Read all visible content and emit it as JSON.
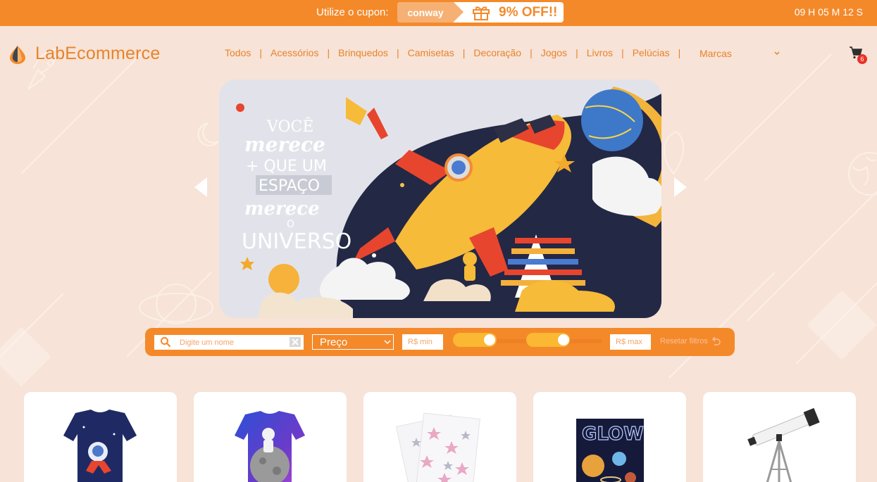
{
  "topbar": {
    "coupon_text": "Utilize o cupon:",
    "coupon_code": "conway",
    "discount": "9% OFF!!",
    "timer": "09 H 05 M 12 S"
  },
  "logo": {
    "text": "LabEcommerce"
  },
  "nav": {
    "items": [
      "Todos",
      "Acessórios",
      "Brinquedos",
      "Camisetas",
      "Decoração",
      "Jogos",
      "Livros",
      "Pelúcias"
    ],
    "brands_label": "Marcas"
  },
  "cart": {
    "count": "6"
  },
  "banner": {
    "lines": [
      "VOCÊ",
      "merece",
      "+ QUE UM",
      "ESPAÇO",
      "merece",
      "O",
      "UNIVERSO"
    ]
  },
  "filters": {
    "search_placeholder": "Digite um nome",
    "sort_selected": "Preço",
    "min_placeholder": "R$ min",
    "max_placeholder": "R$ max",
    "reset_label": "Resetar filtros"
  },
  "products": [
    {
      "icon": "tshirt-navy-astronaut"
    },
    {
      "icon": "tshirt-galaxy-astronaut"
    },
    {
      "icon": "star-stickers"
    },
    {
      "icon": "glow-planets-kit"
    },
    {
      "icon": "telescope"
    }
  ],
  "colors": {
    "accent": "#f4892a",
    "background": "#f7e3d7",
    "badge": "#e8322a"
  }
}
